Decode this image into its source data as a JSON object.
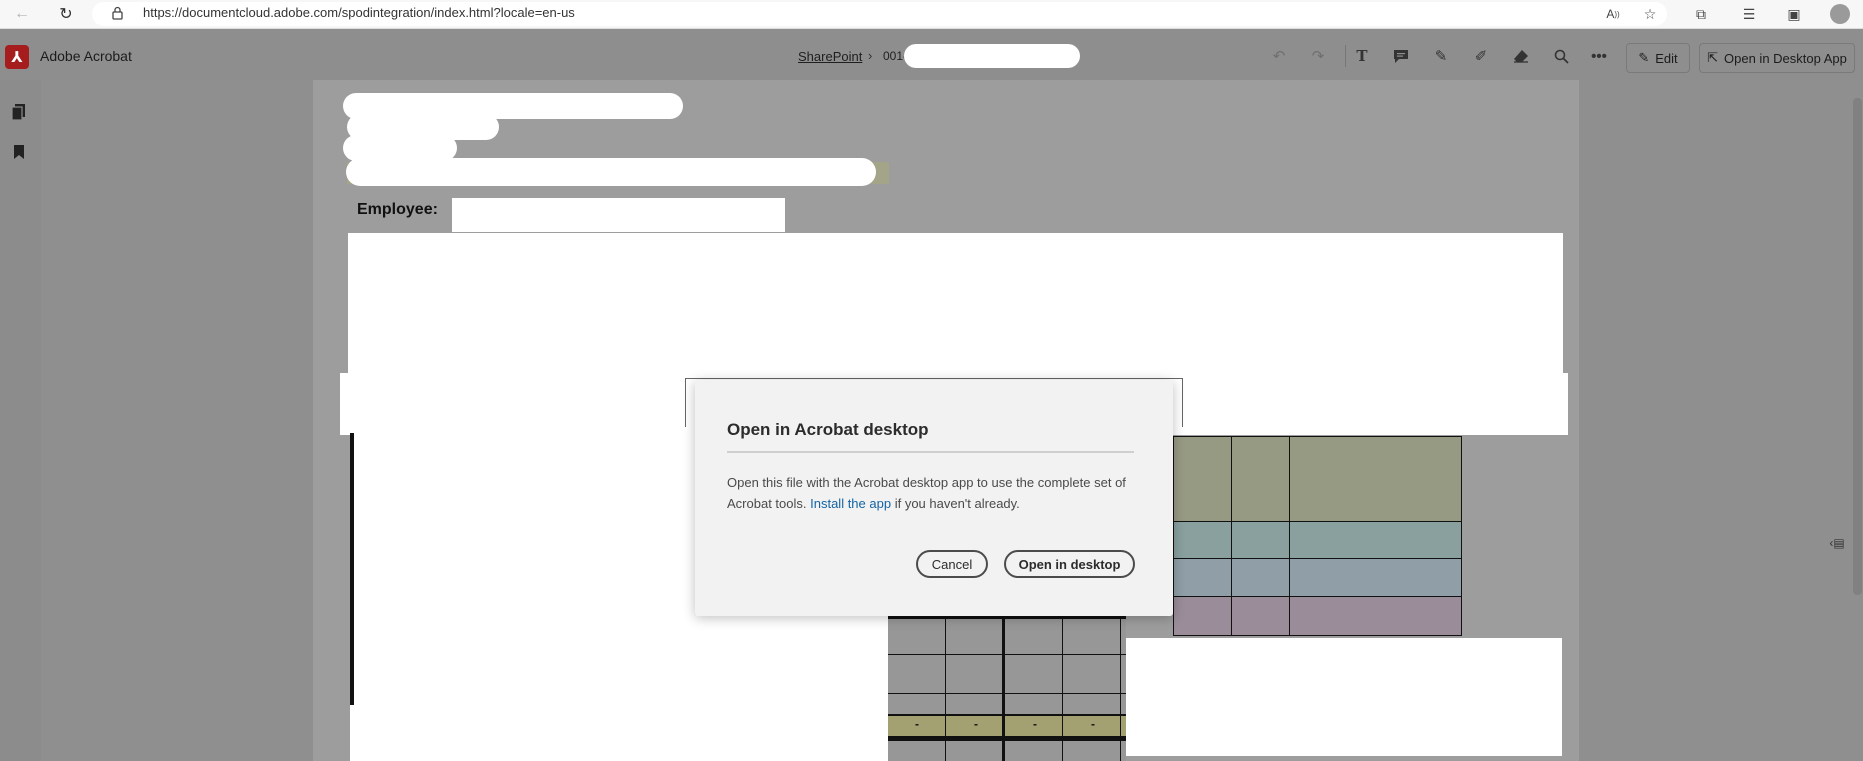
{
  "browser": {
    "url": "https://documentcloud.adobe.com/spodintegration/index.html?locale=en-us",
    "icons": [
      "back-icon",
      "refresh-icon",
      "lock-icon",
      "read-aloud-icon",
      "favorites-add-icon",
      "extensions-icon",
      "favorites-icon",
      "collections-icon",
      "profile-icon"
    ]
  },
  "app": {
    "title": "Adobe Acrobat",
    "breadcrumb": {
      "root": "SharePoint",
      "separator": "›",
      "file": "001-"
    },
    "toolbar": {
      "edit_label": "Edit",
      "open_desktop_label": "Open in Desktop App"
    }
  },
  "document": {
    "employee_label": "Employee:",
    "dash": "-"
  },
  "dialog": {
    "title": "Open in Acrobat desktop",
    "body_prefix": "Open this file with the Acrobat desktop app to use the complete set of Acrobat tools.",
    "link_text": "Install the app",
    "body_suffix": "if you haven't already.",
    "cancel_label": "Cancel",
    "open_label": "Open in desktop"
  },
  "colors": {
    "acrobat_red": "#a51d1d",
    "link_blue": "#1464a5",
    "row_olive": "#979a83",
    "row_teal": "#89a09f",
    "row_blue": "#8f9ea7",
    "row_mauve": "#9a8c99",
    "row_yellow": "#a3a071"
  }
}
